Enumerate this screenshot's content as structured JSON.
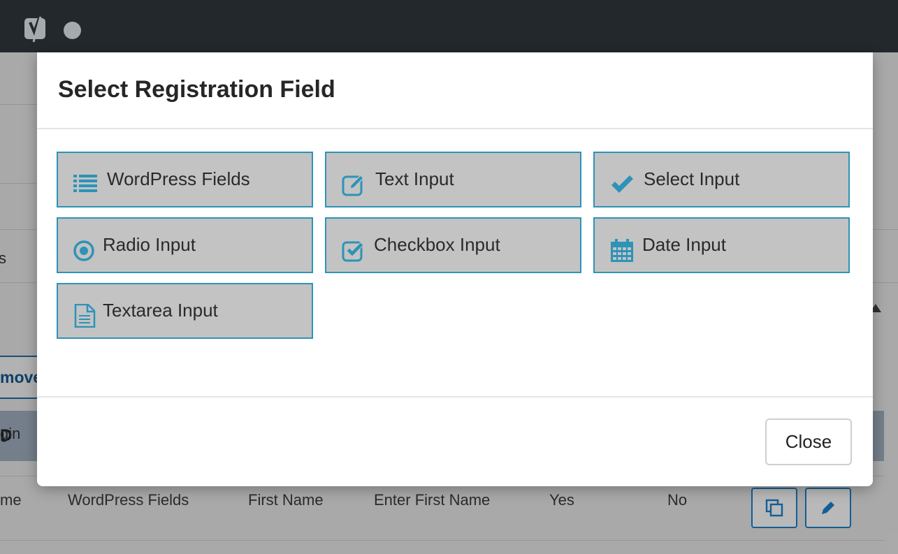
{
  "colors": {
    "accent": "#2d93b7",
    "tile_bg": "#c3c3c3",
    "topbar": "#23282d"
  },
  "modal": {
    "title": "Select Registration Field",
    "fields": [
      {
        "label": "WordPress Fields",
        "icon": "list-icon"
      },
      {
        "label": "Text Input",
        "icon": "edit-icon"
      },
      {
        "label": "Select Input",
        "icon": "checkmark-icon"
      },
      {
        "label": "Radio Input",
        "icon": "radio-icon"
      },
      {
        "label": "Checkbox Input",
        "icon": "checkbox-icon"
      },
      {
        "label": "Date Input",
        "icon": "calendar-icon"
      },
      {
        "label": "Textarea Input",
        "icon": "document-icon"
      }
    ],
    "close_label": "Close"
  },
  "background": {
    "partial_s": "s",
    "remove_label": "move",
    "table_header_partial": "D",
    "row0_partial": "gin",
    "row1": {
      "col0": "me",
      "type": "WordPress Fields",
      "label": "First Name",
      "placeholder": "Enter First Name",
      "required": "Yes",
      "other": "No"
    }
  }
}
